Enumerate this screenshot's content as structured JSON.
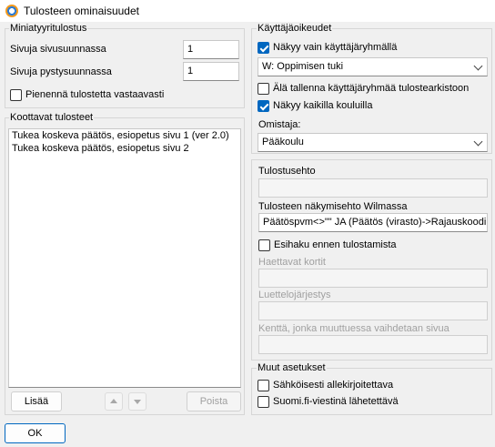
{
  "window": {
    "title": "Tulosteen ominaisuudet"
  },
  "thumbnail": {
    "title": "Miniatyyritulostus",
    "pages_horizontal_label": "Sivuja sivusuunnassa",
    "pages_horizontal_value": "1",
    "pages_vertical_label": "Sivuja pystysuunnassa",
    "pages_vertical_value": "1",
    "shrink_label": "Pienennä tulostetta vastaavasti",
    "shrink_checked": false
  },
  "collected": {
    "title": "Koottavat tulosteet",
    "items": [
      "Tukea koskeva päätös, esiopetus sivu 1 (ver 2.0)",
      "Tukea koskeva päätös, esiopetus sivu 2"
    ],
    "add_label": "Lisää",
    "remove_label": "Poista"
  },
  "permissions": {
    "title": "Käyttäjäoikeudet",
    "only_group_label": "Näkyy vain käyttäjäryhmällä",
    "only_group_checked": true,
    "group_value": "W: Oppimisen tuki",
    "dont_save_label": "Älä tallenna käyttäjäryhmää tulostearkistoon",
    "dont_save_checked": false,
    "all_schools_label": "Näkyy kaikilla kouluilla",
    "all_schools_checked": true,
    "owner_label": "Omistaja:",
    "owner_value": "Pääkoulu"
  },
  "conditions": {
    "print_condition_label": "Tulostusehto",
    "print_condition_value": "",
    "visibility_label": "Tulosteen näkymisehto Wilmassa",
    "visibility_value": "Päätöspvm<>\"\" JA (Päätös (virasto)->Rajauskoodi",
    "preview_label": "Esihaku ennen tulostamista",
    "preview_checked": false,
    "cards_label": "Haettavat kortit",
    "list_order_label": "Luettelojärjestys",
    "page_break_label": "Kenttä, jonka muuttuessa vaihdetaan sivua"
  },
  "other": {
    "title": "Muut asetukset",
    "e_sign_label": "Sähköisesti allekirjoitettava",
    "e_sign_checked": false,
    "suomifi_label": "Suomi.fi-viestinä lähetettävä",
    "suomifi_checked": false
  },
  "footer": {
    "ok_label": "OK"
  }
}
